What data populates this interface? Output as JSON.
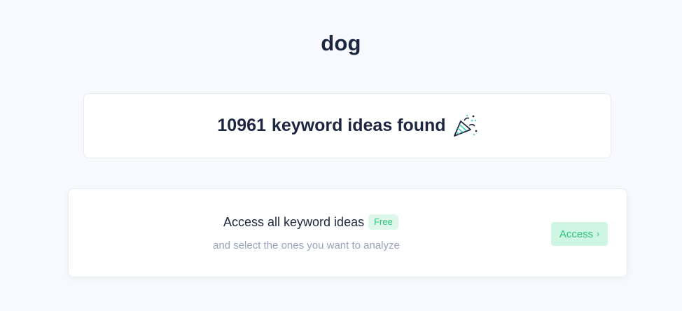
{
  "query": {
    "title": "dog"
  },
  "results": {
    "count": "10961",
    "label": "keyword ideas found",
    "icon": "party-popper-icon"
  },
  "access_card": {
    "heading": "Access all keyword ideas",
    "badge": "Free",
    "subtext": "and select the ones you want to analyze",
    "button_label": "Access",
    "button_icon": "chevron-right-icon",
    "button_chevron": "›"
  },
  "colors": {
    "background": "#f8f9fc",
    "text": "#1c2640",
    "muted_text": "#96a3bd",
    "accent_green": "#2bc47d",
    "accent_green_bg": "#cef6e2"
  }
}
